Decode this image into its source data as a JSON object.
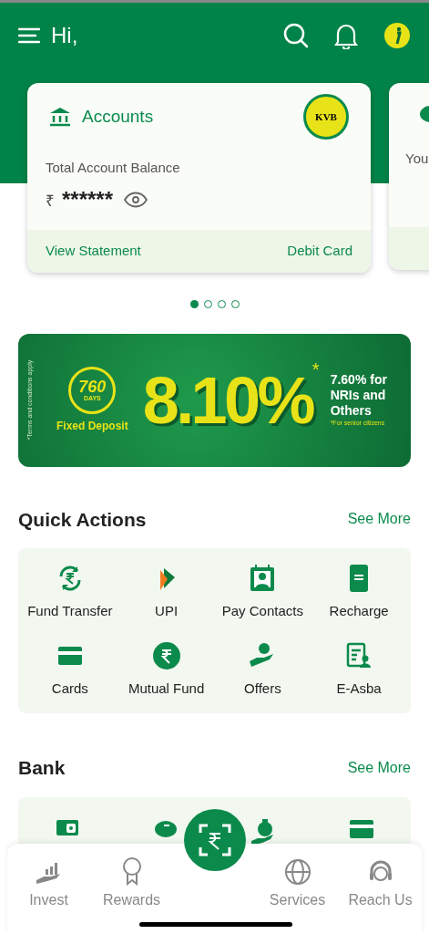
{
  "header": {
    "greeting": "Hi,"
  },
  "account_cards": [
    {
      "title": "Accounts",
      "logo": "KVB",
      "label": "Total Account Balance",
      "currency": "₹",
      "balance": "******",
      "links": [
        "View Statement",
        "Debit Card"
      ]
    },
    {
      "label": "You"
    }
  ],
  "carousel_dots": [
    {
      "selected": true
    },
    {
      "selected": false
    },
    {
      "selected": false
    },
    {
      "selected": false
    }
  ],
  "banner": {
    "badge_number": "760",
    "badge_unit": "DAYS",
    "product": "Fixed Deposit",
    "rate": "8.10%",
    "asterisk": "*",
    "side_text": "7.60% for NRIs and Others",
    "side_note": "*For senior citizens",
    "terms": "*Terms and conditions apply"
  },
  "quick_actions": {
    "title": "Quick Actions",
    "see_more": "See More",
    "items": [
      {
        "kind": "transfer",
        "label": "Fund Transfer"
      },
      {
        "kind": "upi",
        "label": "UPI"
      },
      {
        "kind": "contacts",
        "label": "Pay Contacts"
      },
      {
        "kind": "recharge",
        "label": "Recharge"
      },
      {
        "kind": "cards",
        "label": "Cards"
      },
      {
        "kind": "mutual",
        "label": "Mutual Fund"
      },
      {
        "kind": "offers",
        "label": "Offers"
      },
      {
        "kind": "easba",
        "label": "E-Asba"
      }
    ]
  },
  "bank": {
    "title": "Bank",
    "see_more": "See More",
    "items": [
      {
        "kind": "wallet"
      },
      {
        "kind": "piggy"
      },
      {
        "kind": "moneybag"
      },
      {
        "kind": "cards"
      }
    ]
  },
  "bottom_nav": [
    {
      "kind": "invest",
      "label": "Invest"
    },
    {
      "kind": "rewards",
      "label": "Rewards"
    },
    {
      "kind": "scan"
    },
    {
      "kind": "services",
      "label": "Services"
    },
    {
      "kind": "reach",
      "label": "Reach Us"
    }
  ]
}
